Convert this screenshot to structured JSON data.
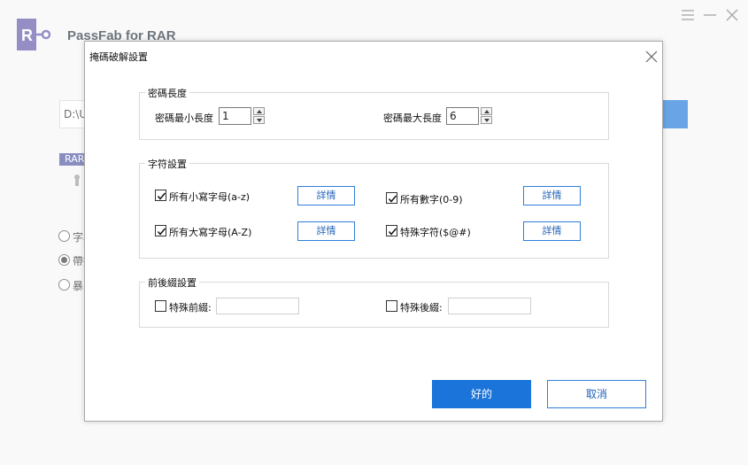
{
  "app": {
    "title": "PassFab for RAR",
    "logo_letter": "R",
    "brand_color": "#5b52a6",
    "path_value": "D:\\U",
    "file_badge": "RAR",
    "attack_options": [
      {
        "label": "字典",
        "selected": false
      },
      {
        "label": "帶掩",
        "selected": true
      },
      {
        "label": "暴力",
        "selected": false
      }
    ]
  },
  "dialog": {
    "title": "掩碼破解設置",
    "length_group": {
      "title": "密碼長度",
      "min_label": "密碼最小長度",
      "min_value": "1",
      "max_label": "密碼最大長度",
      "max_value": "6"
    },
    "charset_group": {
      "title": "字符設置",
      "lowercase": {
        "label": "所有小寫字母(a-z)",
        "checked": true
      },
      "uppercase": {
        "label": "所有大寫字母(A-Z)",
        "checked": true
      },
      "digits": {
        "label": "所有數字(0-9)",
        "checked": true
      },
      "special": {
        "label": "特殊字符($@#)",
        "checked": true
      },
      "details_label": "詳情"
    },
    "affix_group": {
      "title": "前後綴設置",
      "prefix": {
        "label": "特殊前綴:",
        "checked": false,
        "value": ""
      },
      "suffix": {
        "label": "特殊後綴:",
        "checked": false,
        "value": ""
      }
    },
    "ok_label": "好的",
    "cancel_label": "取消"
  },
  "colors": {
    "accent": "#1a74d9",
    "accent_border": "#2e7fd9"
  }
}
